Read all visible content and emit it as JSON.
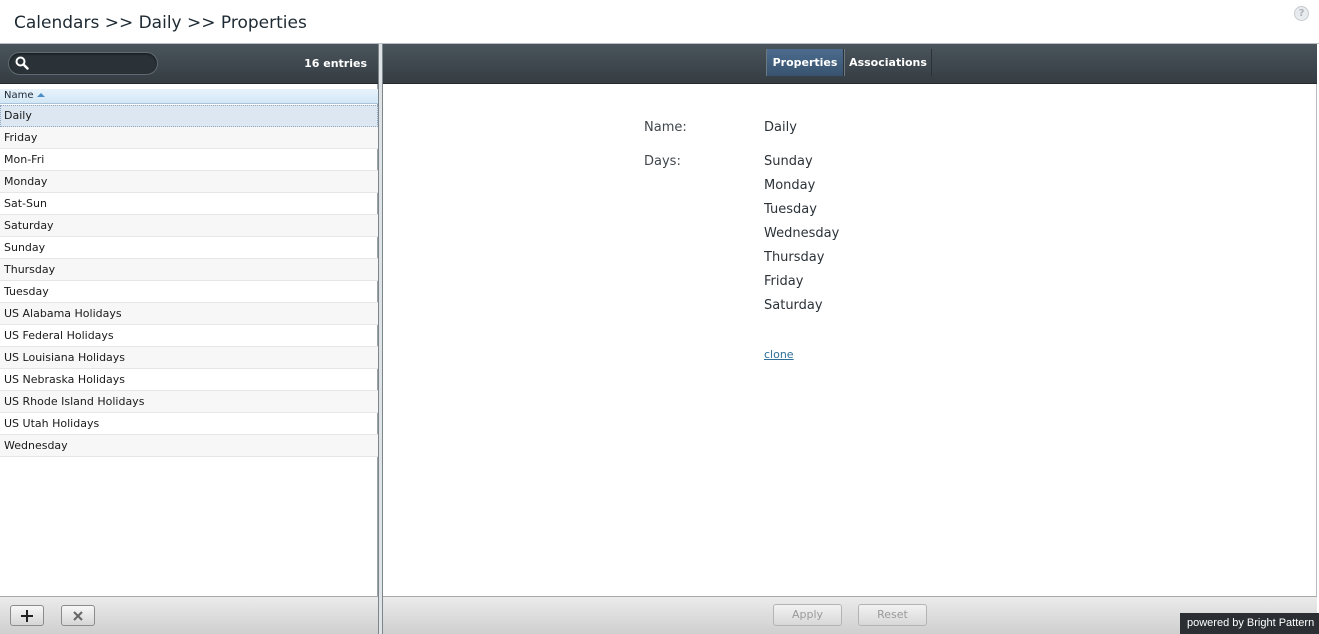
{
  "header": {
    "breadcrumb": "Calendars >> Daily >> Properties",
    "help_icon": "?"
  },
  "left_panel": {
    "search": {
      "value": "",
      "placeholder": ""
    },
    "entries_count": "16 entries",
    "column_header": "Name",
    "sort_direction": "ascending",
    "items": [
      "Daily",
      "Friday",
      "Mon-Fri",
      "Monday",
      "Sat-Sun",
      "Saturday",
      "Sunday",
      "Thursday",
      "Tuesday",
      "US Alabama Holidays",
      "US Federal Holidays",
      "US Louisiana Holidays",
      "US Nebraska Holidays",
      "US Rhode Island Holidays",
      "US Utah Holidays",
      "Wednesday"
    ],
    "selected_item": "Daily",
    "add_icon": "plus-icon",
    "delete_icon": "x-icon"
  },
  "tabs": {
    "properties": "Properties",
    "associations": "Associations",
    "active": "Properties"
  },
  "form": {
    "name_label": "Name:",
    "name_value": "Daily",
    "days_label": "Days:",
    "days": [
      "Sunday",
      "Monday",
      "Tuesday",
      "Wednesday",
      "Thursday",
      "Friday",
      "Saturday"
    ],
    "clone_link": "clone"
  },
  "footer": {
    "apply": "Apply",
    "reset": "Reset",
    "powered_by": "powered by Bright Pattern"
  },
  "colors": {
    "toolbar_dark": "#3f484e",
    "active_tab": "#4c6b8e",
    "selected_row": "#dde7f2",
    "link": "#2f6f99"
  }
}
